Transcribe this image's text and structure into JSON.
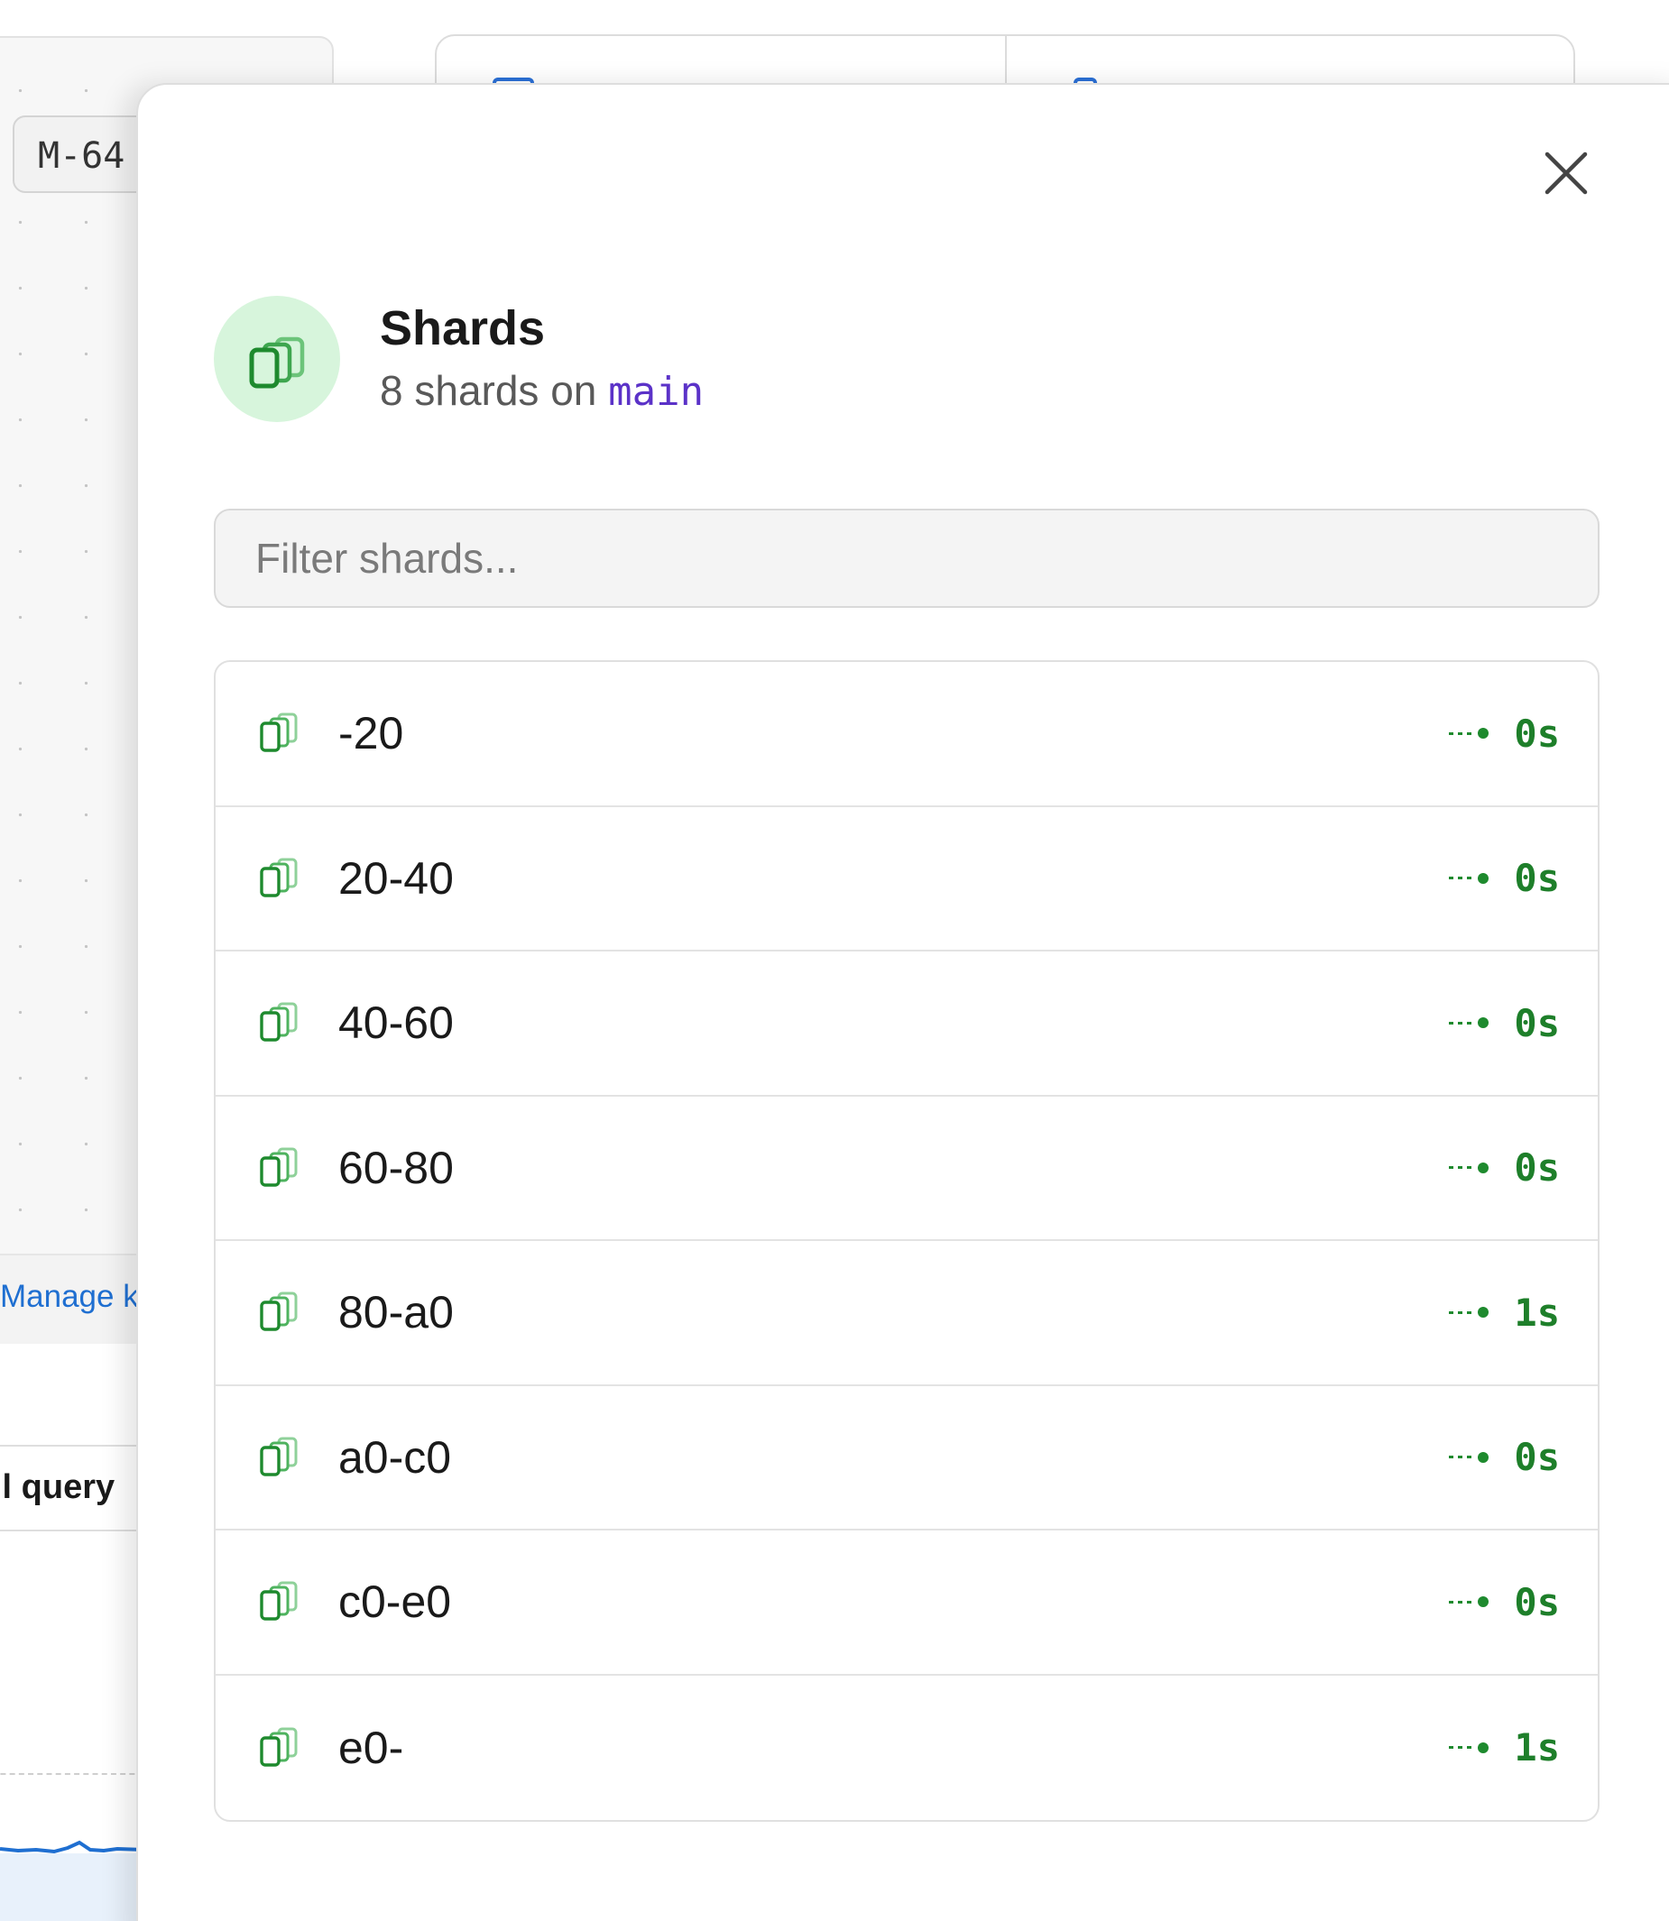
{
  "background": {
    "chip_label": "M-64",
    "manage_link": "Manage k",
    "query_heading": "ll query"
  },
  "drawer": {
    "close_icon": "close-icon",
    "header": {
      "icon": "shards-icon",
      "title": "Shards",
      "subtitle_prefix": "8 shards on",
      "branch": "main"
    },
    "filter": {
      "placeholder": "Filter shards...",
      "value": ""
    },
    "shards": [
      {
        "name": "-20",
        "lag": "0s"
      },
      {
        "name": "20-40",
        "lag": "0s"
      },
      {
        "name": "40-60",
        "lag": "0s"
      },
      {
        "name": "60-80",
        "lag": "0s"
      },
      {
        "name": "80-a0",
        "lag": "1s"
      },
      {
        "name": "a0-c0",
        "lag": "0s"
      },
      {
        "name": "c0-e0",
        "lag": "0s"
      },
      {
        "name": "e0-",
        "lag": "1s"
      }
    ]
  },
  "colors": {
    "accent_green": "#1e8a2e",
    "icon_bg": "#d7f5dc",
    "branch_purple": "#5b32c8",
    "link_blue": "#1f6fd1"
  }
}
